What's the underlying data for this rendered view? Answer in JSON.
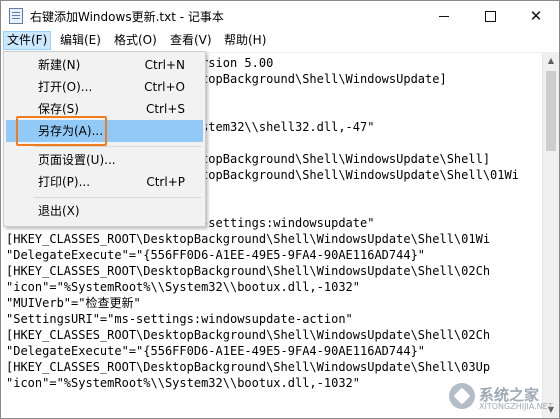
{
  "window": {
    "title": "右键添加Windows更新.txt - 记事本"
  },
  "menubar": {
    "items": [
      {
        "label": "文件(F)"
      },
      {
        "label": "编辑(E)"
      },
      {
        "label": "格式(O)"
      },
      {
        "label": "查看(V)"
      },
      {
        "label": "帮助(H)"
      }
    ]
  },
  "file_menu": {
    "items": [
      {
        "label": "新建(N)",
        "shortcut": "Ctrl+N"
      },
      {
        "label": "打开(O)...",
        "shortcut": "Ctrl+O"
      },
      {
        "label": "保存(S)",
        "shortcut": "Ctrl+S"
      },
      {
        "label": "另存为(A)...",
        "shortcut": ""
      },
      {
        "label": "页面设置(U)...",
        "shortcut": ""
      },
      {
        "label": "打印(P)...",
        "shortcut": "Ctrl+P"
      },
      {
        "label": "退出(X)",
        "shortcut": ""
      }
    ],
    "highlighted": "另存为(A)..."
  },
  "editor": {
    "lines": [
      "                          ersion 5.00",
      "                          ktopBackground\\Shell\\WindowsUpdate]",
      "",
      "                          ystem32\\\\shell32.dll,-47\"",
      "",
      "                          ktopBackground\\Shell\\WindowsUpdate\\Shell]",
      "                          ktopBackground\\Shell\\WindowsUpdate\\Shell\\01Wi",
      "",
      "                          s-settings:windowsupdate\"",
      "[HKEY_CLASSES_ROOT\\DesktopBackground\\Shell\\WindowsUpdate\\Shell\\01Wi",
      "\"DelegateExecute\"=\"{556FF0D6-A1EE-49E5-9FA4-90AE116AD744}\"",
      "[HKEY_CLASSES_ROOT\\DesktopBackground\\Shell\\WindowsUpdate\\Shell\\02Ch",
      "\"icon\"=\"%SystemRoot%\\\\System32\\\\bootux.dll,-1032\"",
      "\"MUIVerb\"=\"检查更新\"",
      "\"SettingsURI\"=\"ms-settings:windowsupdate-action\"",
      "[HKEY_CLASSES_ROOT\\DesktopBackground\\Shell\\WindowsUpdate\\Shell\\02Ch",
      "\"DelegateExecute\"=\"{556FF0D6-A1EE-49E5-9FA4-90AE116AD744}\"",
      "[HKEY_CLASSES_ROOT\\DesktopBackground\\Shell\\WindowsUpdate\\Shell\\03Up",
      "\"icon\"=\"%SystemRoot%\\\\System32\\\\bootux.dll,-1032\""
    ]
  },
  "watermark": {
    "text": "系统之家",
    "sub": "XITONGZHIJIA.NET"
  },
  "icons": {
    "app": "notepad-icon",
    "minimize": "minimize-icon",
    "maximize": "maximize-icon",
    "close": "close-icon"
  },
  "colors": {
    "menu_highlight": "#91c9f7",
    "focus_outline": "#f07c1e",
    "menu_active": "#cce8ff"
  }
}
